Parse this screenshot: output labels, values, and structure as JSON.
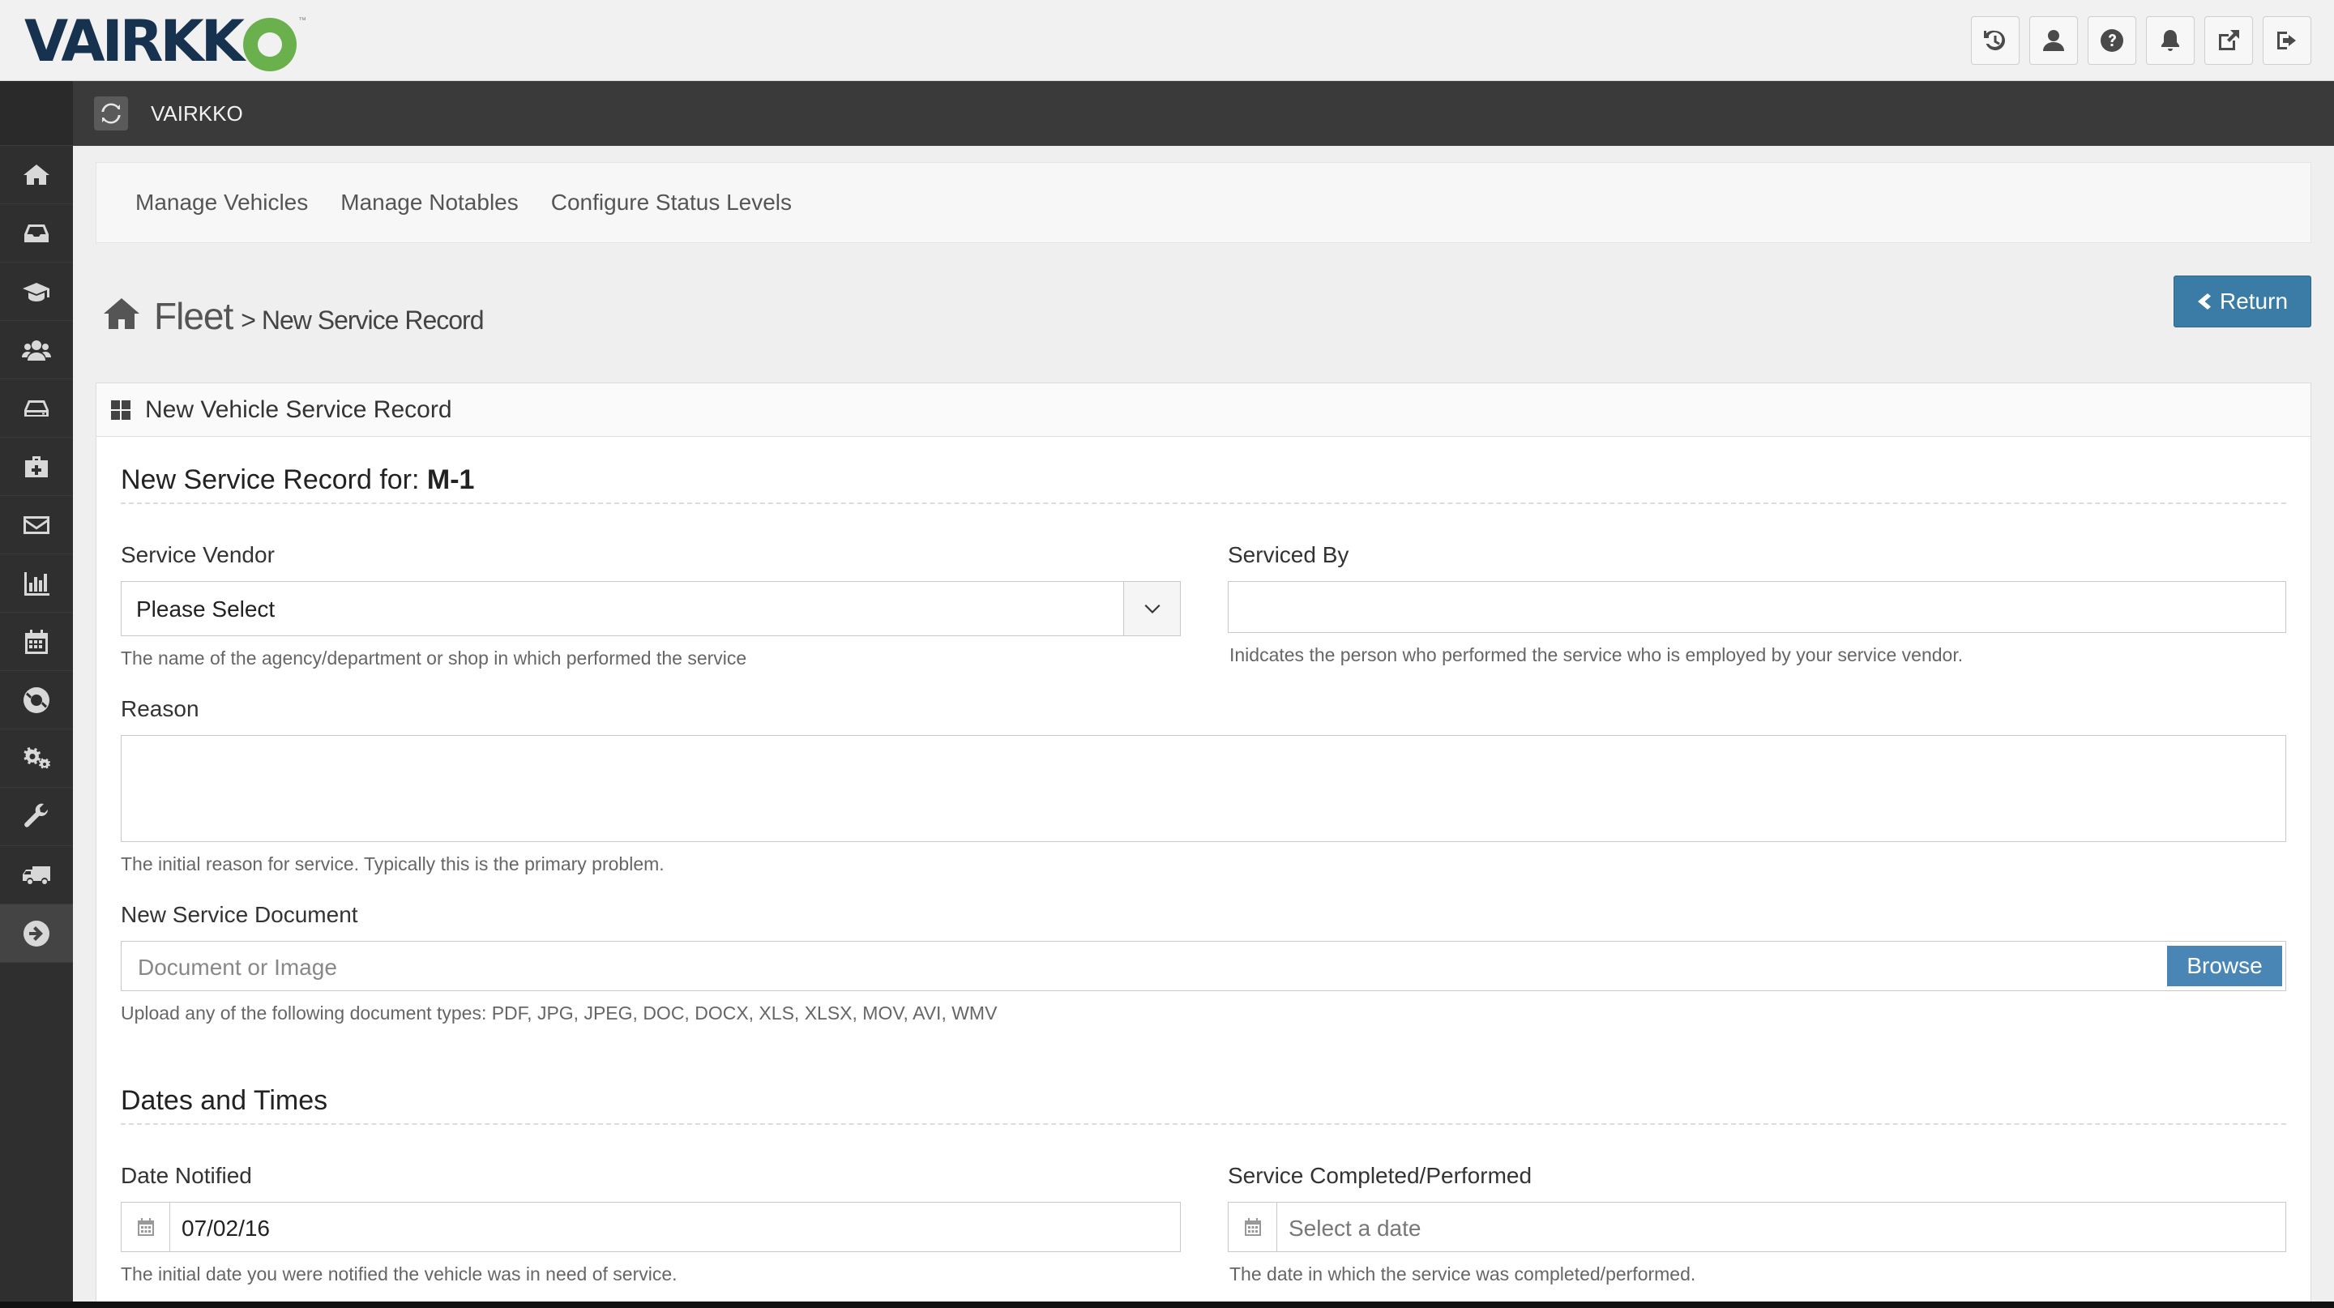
{
  "app": {
    "logo_text": "VAIRKK",
    "title": "VAIRKKO"
  },
  "top_icons": [
    "history-icon",
    "user-icon",
    "help-icon",
    "bell-icon",
    "external-link-icon",
    "logout-icon"
  ],
  "sidebar": {
    "items": [
      "home-icon",
      "inbox-icon",
      "graduation-cap-icon",
      "users-icon",
      "hdd-icon",
      "medkit-icon",
      "envelope-icon",
      "bar-chart-icon",
      "calendar-icon",
      "life-ring-icon",
      "gears-icon",
      "wrench-icon",
      "truck-icon",
      "arrow-circle-right-icon"
    ]
  },
  "nav": {
    "tabs": [
      "Manage Vehicles",
      "Manage Notables",
      "Configure Status Levels"
    ]
  },
  "breadcrumb": {
    "main": "Fleet",
    "sub": "> New Service Record"
  },
  "return_label": "Return",
  "panel": {
    "title": "New Vehicle Service Record"
  },
  "form": {
    "heading_prefix": "New Service Record for: ",
    "heading_vehicle": "M-1",
    "service_vendor": {
      "label": "Service Vendor",
      "value": "Please Select",
      "help": "The name of the agency/department or shop in which performed the service"
    },
    "serviced_by": {
      "label": "Serviced By",
      "value": "",
      "help": "Inidcates the person who performed the service who is employed by your service vendor."
    },
    "reason": {
      "label": "Reason",
      "value": "",
      "help": "The initial reason for service. Typically this is the primary problem."
    },
    "document": {
      "label": "New Service Document",
      "placeholder": "Document or Image",
      "browse_label": "Browse",
      "help": "Upload any of the following document types: PDF, JPG, JPEG, DOC, DOCX, XLS, XLSX, MOV, AVI, WMV"
    },
    "dates_heading": "Dates and Times",
    "date_notified": {
      "label": "Date Notified",
      "value": "07/02/16",
      "help": "The initial date you were notified the vehicle was in need of service."
    },
    "service_completed": {
      "label": "Service Completed/Performed",
      "placeholder": "Select a date",
      "help": "The date in which the service was completed/performed."
    }
  }
}
